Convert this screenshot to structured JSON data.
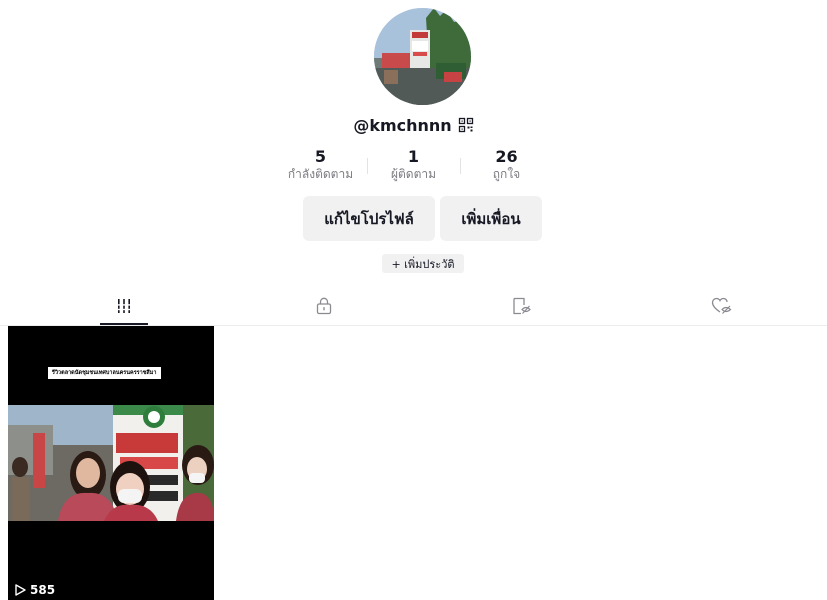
{
  "profile": {
    "handle": "@kmchnnn",
    "avatar_icon": "profile-photo-market-sign",
    "qr_icon": "qr-code-icon"
  },
  "stats": [
    {
      "value": "5",
      "label": "กำลังติดตาม"
    },
    {
      "value": "1",
      "label": "ผู้ติดตาม"
    },
    {
      "value": "26",
      "label": "ถูกใจ"
    }
  ],
  "actions": {
    "edit_profile": "แก้ไขโปรไฟล์",
    "add_friend": "เพิ่มเพื่อน",
    "add_bio": "+ เพิ่มประวัติ"
  },
  "tabs": [
    {
      "name": "videos",
      "icon": "grid-icon",
      "active": true
    },
    {
      "name": "private",
      "icon": "lock-icon",
      "active": false
    },
    {
      "name": "reposts",
      "icon": "bookmark-hidden-icon",
      "active": false
    },
    {
      "name": "liked",
      "icon": "heart-hidden-icon",
      "active": false
    }
  ],
  "videos": [
    {
      "caption": "รีวิวตลาดนัดชุมชนเทศบาลนครนครราชสีมา",
      "views": "585",
      "play_icon": "play-icon"
    }
  ],
  "colors": {
    "text": "#161823",
    "muted": "#7a7b80",
    "button_bg": "#f1f1f2",
    "divider": "#ececec"
  }
}
